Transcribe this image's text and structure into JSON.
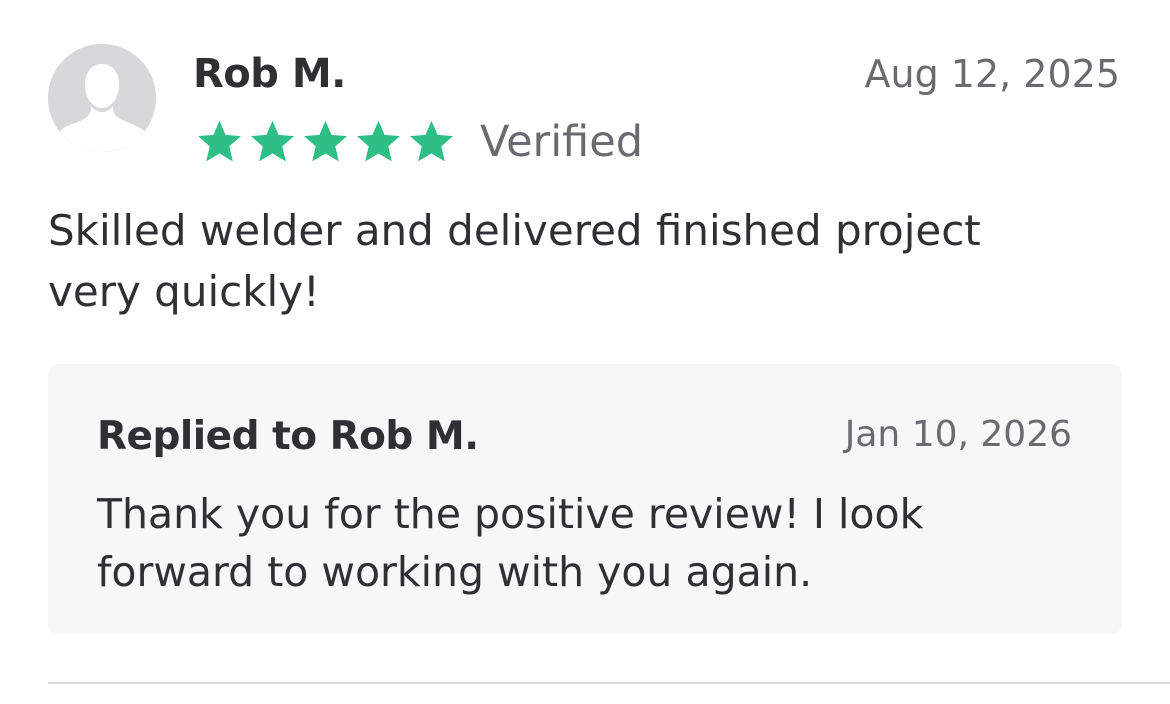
{
  "review": {
    "reviewer_name": "Rob M.",
    "date": "Aug 12, 2025",
    "rating": 5,
    "rating_max": 5,
    "verified_label": "Verified",
    "body": "Skilled welder and delivered finished project very quickly!",
    "avatar_icon": "default-user-avatar-icon"
  },
  "reply": {
    "title": "Replied to Rob M.",
    "date": "Jan 10, 2026",
    "body": "Thank you for the positive review! I look forward to working with you again."
  },
  "colors": {
    "star": "#2dbf86",
    "text_primary": "#2f3033",
    "text_secondary": "#6a6b70",
    "reply_background": "#f7f7f8",
    "avatar_background": "#d7d8da"
  },
  "icons": {
    "star": "star-icon"
  }
}
